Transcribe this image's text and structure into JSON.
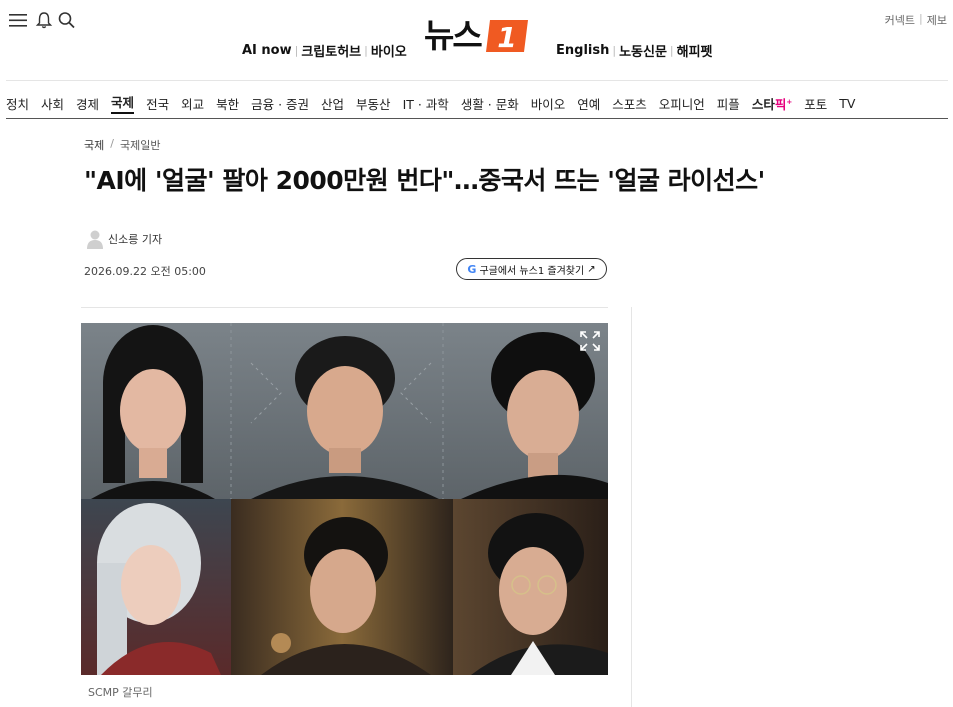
{
  "header": {
    "util_links": [
      "커넥트",
      "제보"
    ],
    "logo_text": "뉴스",
    "logo_badge": "1",
    "sub_left": [
      "AI now",
      "크립토허브",
      "바이오"
    ],
    "sub_right": [
      "English",
      "노동신문",
      "해피펫"
    ],
    "icons": [
      "menu-icon",
      "bell-icon",
      "search-icon"
    ]
  },
  "nav": {
    "categories": [
      "정치",
      "사회",
      "경제",
      "국제",
      "전국",
      "외교",
      "북한",
      "금융 · 증권",
      "산업",
      "부동산",
      "IT · 과학",
      "생활 · 문화",
      "바이오",
      "연예",
      "스포츠",
      "오피니언",
      "피플"
    ],
    "active": "국제",
    "star_pick": {
      "prefix": "스타",
      "accent": "픽",
      "mark": "+"
    },
    "extra": [
      "포토",
      "TV"
    ]
  },
  "article": {
    "breadcrumb": [
      "국제",
      "국제일반"
    ],
    "headline": "\"AI에 '얼굴' 팔아 2000만원 번다\"…중국서 뜨는 '얼굴 라이선스'",
    "author": "신소릉 기자",
    "date": "2026.09.22 오전 05:00",
    "google_button": "구글에서 뉴스1 즐겨찾기",
    "google_arrow": "↗",
    "image_caption": "SCMP 갈무리"
  },
  "colors": {
    "brand_orange": "#f05a22",
    "star_pink": "#e6007e",
    "google_blue": "#4285f4"
  }
}
